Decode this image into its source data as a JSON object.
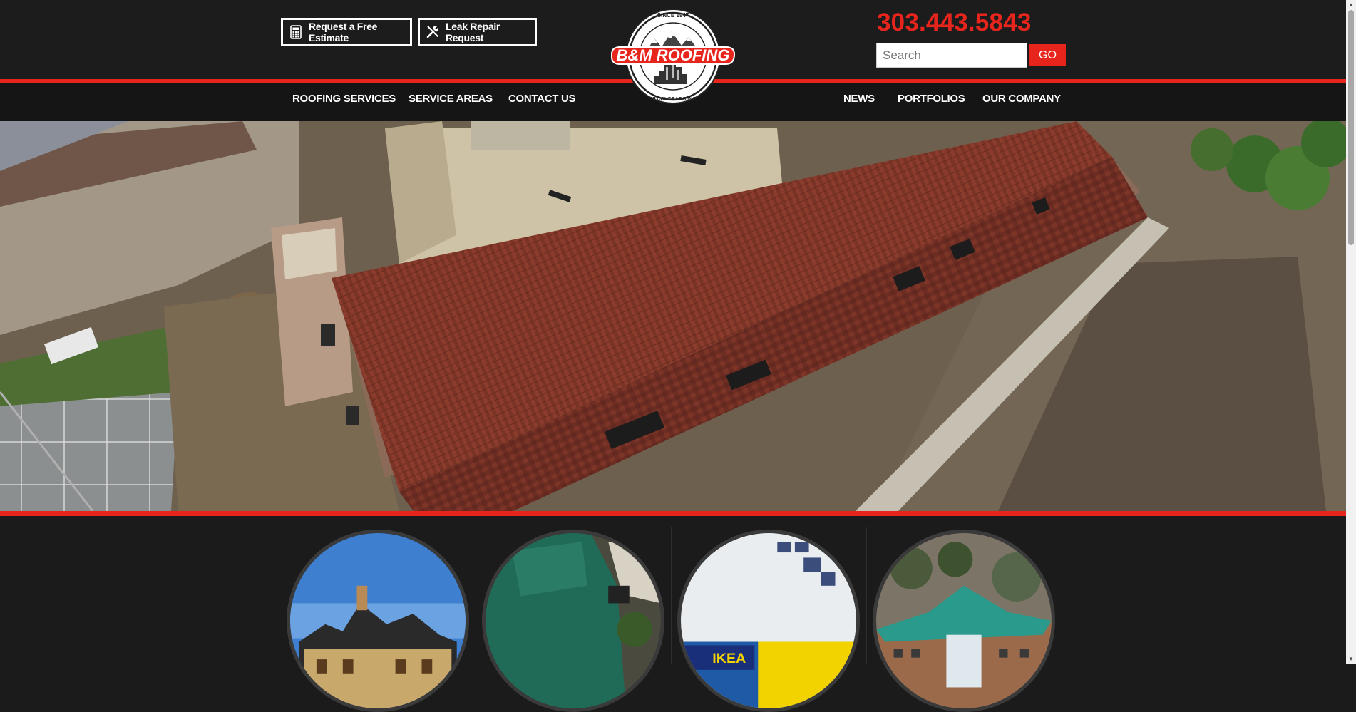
{
  "header": {
    "estimate_label": "Request a Free Estimate",
    "leak_label": "Leak Repair Request",
    "phone": "303.443.5843",
    "search_placeholder": "Search",
    "go_label": "GO"
  },
  "logo": {
    "top_text": "SINCE 1947",
    "name": "B&M ROOFING",
    "bottom_text": "OF COLORADO INC."
  },
  "nav": {
    "left": [
      "ROOFING SERVICES",
      "SERVICE AREAS",
      "CONTACT US"
    ],
    "right": [
      "NEWS",
      "PORTFOLIOS",
      "OUR COMPANY"
    ]
  },
  "thumbnails": {
    "ikea_sign": "IKEA"
  },
  "colors": {
    "brand_red": "#e8251c",
    "header_bg": "#1c1c1c"
  },
  "icons": [
    "calculator-icon",
    "tools-icon"
  ]
}
